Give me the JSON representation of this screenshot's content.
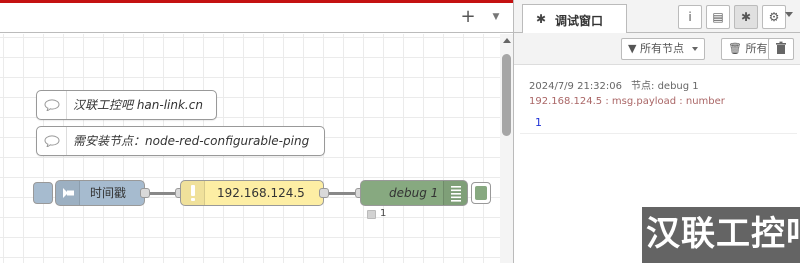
{
  "workspace": {
    "tabbar": {
      "add_label": "+",
      "menu_label": "▼"
    },
    "comments": [
      {
        "text": "汉联工控吧 han-link.cn"
      },
      {
        "text": "需安装节点：node-red-configurable-ping"
      }
    ],
    "nodes": {
      "inject": {
        "label": "时间戳"
      },
      "ping": {
        "label": "192.168.124.5"
      },
      "debug": {
        "label": "debug 1",
        "status_text": "1"
      }
    },
    "colors": {
      "inject": "#a6bbcf",
      "ping": "#fdeea4",
      "debug": "#87a980",
      "accent_red": "#c41111"
    }
  },
  "sidebar": {
    "active_tab": {
      "icon": "bug-icon",
      "label": "调试窗口"
    },
    "tab_buttons": [
      {
        "name": "info-icon",
        "glyph": "i"
      },
      {
        "name": "book-icon",
        "glyph": "▤"
      },
      {
        "name": "bug-icon",
        "glyph": "✱"
      },
      {
        "name": "gear-icon",
        "glyph": "⚙"
      }
    ],
    "toolbar": {
      "filter_label": "所有节点",
      "clear_scope_label": "所有"
    },
    "message": {
      "timestamp": "2024/7/9 21:32:06",
      "node_label": "节点: debug 1",
      "topic": "192.168.124.5 : msg.payload : number",
      "value": "1"
    }
  },
  "watermark": {
    "text": "汉联工控吧"
  }
}
